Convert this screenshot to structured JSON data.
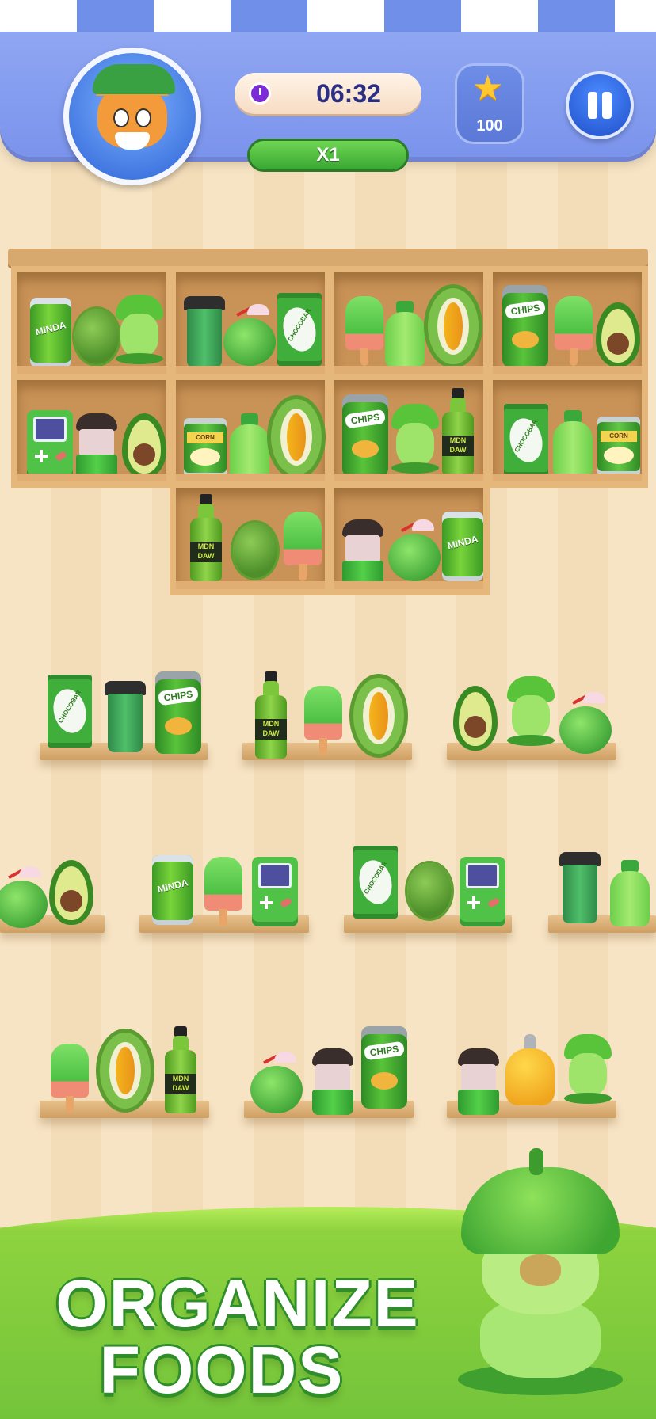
{
  "header": {
    "timer": "06:32",
    "multiplier": "X1",
    "stars": "100"
  },
  "icons": {
    "avatar": "cat-avatar-icon",
    "timer": "clock-icon",
    "star": "star-icon",
    "pause": "pause-icon"
  },
  "labels": {
    "soda": "MINDA",
    "chips": "CHIPS",
    "corn": "CORN",
    "choco": "CHOCOBAR",
    "bottle": "MDN DAW"
  },
  "cabinet": {
    "cells": [
      [
        "soda-can",
        "durian-whole",
        "capybara-toy"
      ],
      [
        "coffee-cup",
        "coconut-drink",
        "chocobar"
      ],
      [
        "popsicle",
        "yogurt-bottle",
        "durian-half"
      ],
      [
        "chips-can",
        "popsicle",
        "avocado"
      ],
      [
        "game-console",
        "blender",
        "avocado"
      ],
      [
        "corn-can",
        "yogurt-bottle",
        "durian-half"
      ],
      [
        "chips-can",
        "capybara-toy",
        "soda-bottle"
      ],
      [
        "chocobar",
        "yogurt-bottle",
        "corn-can"
      ],
      [
        "soda-bottle",
        "durian-whole",
        "popsicle"
      ],
      [
        "blender",
        "coconut-drink",
        "soda-can"
      ]
    ]
  },
  "shelves": [
    [
      "chocobar",
      "coffee-cup",
      "chips-can"
    ],
    [
      "soda-bottle",
      "popsicle",
      "durian-half"
    ],
    [
      "avocado",
      "capybara-toy",
      "coconut-drink"
    ],
    [
      "coconut-drink",
      "avocado"
    ],
    [
      "soda-can",
      "popsicle",
      "game-console"
    ],
    [
      "chocobar",
      "durian-whole",
      "game-console"
    ],
    [
      "coffee-cup",
      "yogurt-bottle"
    ],
    [
      "popsicle",
      "durian-half",
      "soda-bottle"
    ],
    [
      "coconut-drink",
      "blender",
      "chips-can"
    ],
    [
      "blender",
      "honey-jar",
      "capybara-toy"
    ]
  ],
  "banner": {
    "line1": "ORGANIZE",
    "line2": "FOODS"
  },
  "colors": {
    "header": "#8fa6f2",
    "accent_green": "#4bc043",
    "timer_text": "#2b2f86",
    "wood": "#e6b77a"
  }
}
